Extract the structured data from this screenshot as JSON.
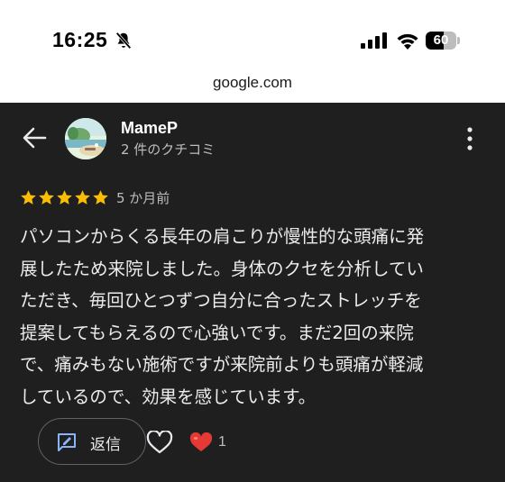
{
  "status_bar": {
    "time": "16:25",
    "battery_level": "60",
    "battery_fraction": 0.6,
    "icons": [
      "bell-slash-icon",
      "cellular-signal-icon",
      "wifi-icon",
      "battery-icon"
    ]
  },
  "browser": {
    "url": "google.com"
  },
  "review": {
    "author": "MameP",
    "review_count": "2 件のクチコミ",
    "rating": 5,
    "rating_max": 5,
    "date": "5 か月前",
    "text_lines": [
      "パソコンからくる長年の肩こりが慢性的な頭痛に発",
      "展したため来院しました。身体のクセを分析してい",
      "ただき、毎回ひとつずつ自分に合ったストレッチを",
      "提案してもらえるので心強いです。まだ2回の来院",
      "で、痛みもない施術ですが来院前よりも頭痛が軽減",
      "しているので、効果を感じています。"
    ],
    "reply_label": "返信",
    "reaction_count": "1"
  },
  "colors": {
    "panel_bg": "#1f1f1f",
    "star": "#fbbc04",
    "heart": "#e53935",
    "text": "#ececec",
    "muted_text": "#bdbdbd"
  }
}
